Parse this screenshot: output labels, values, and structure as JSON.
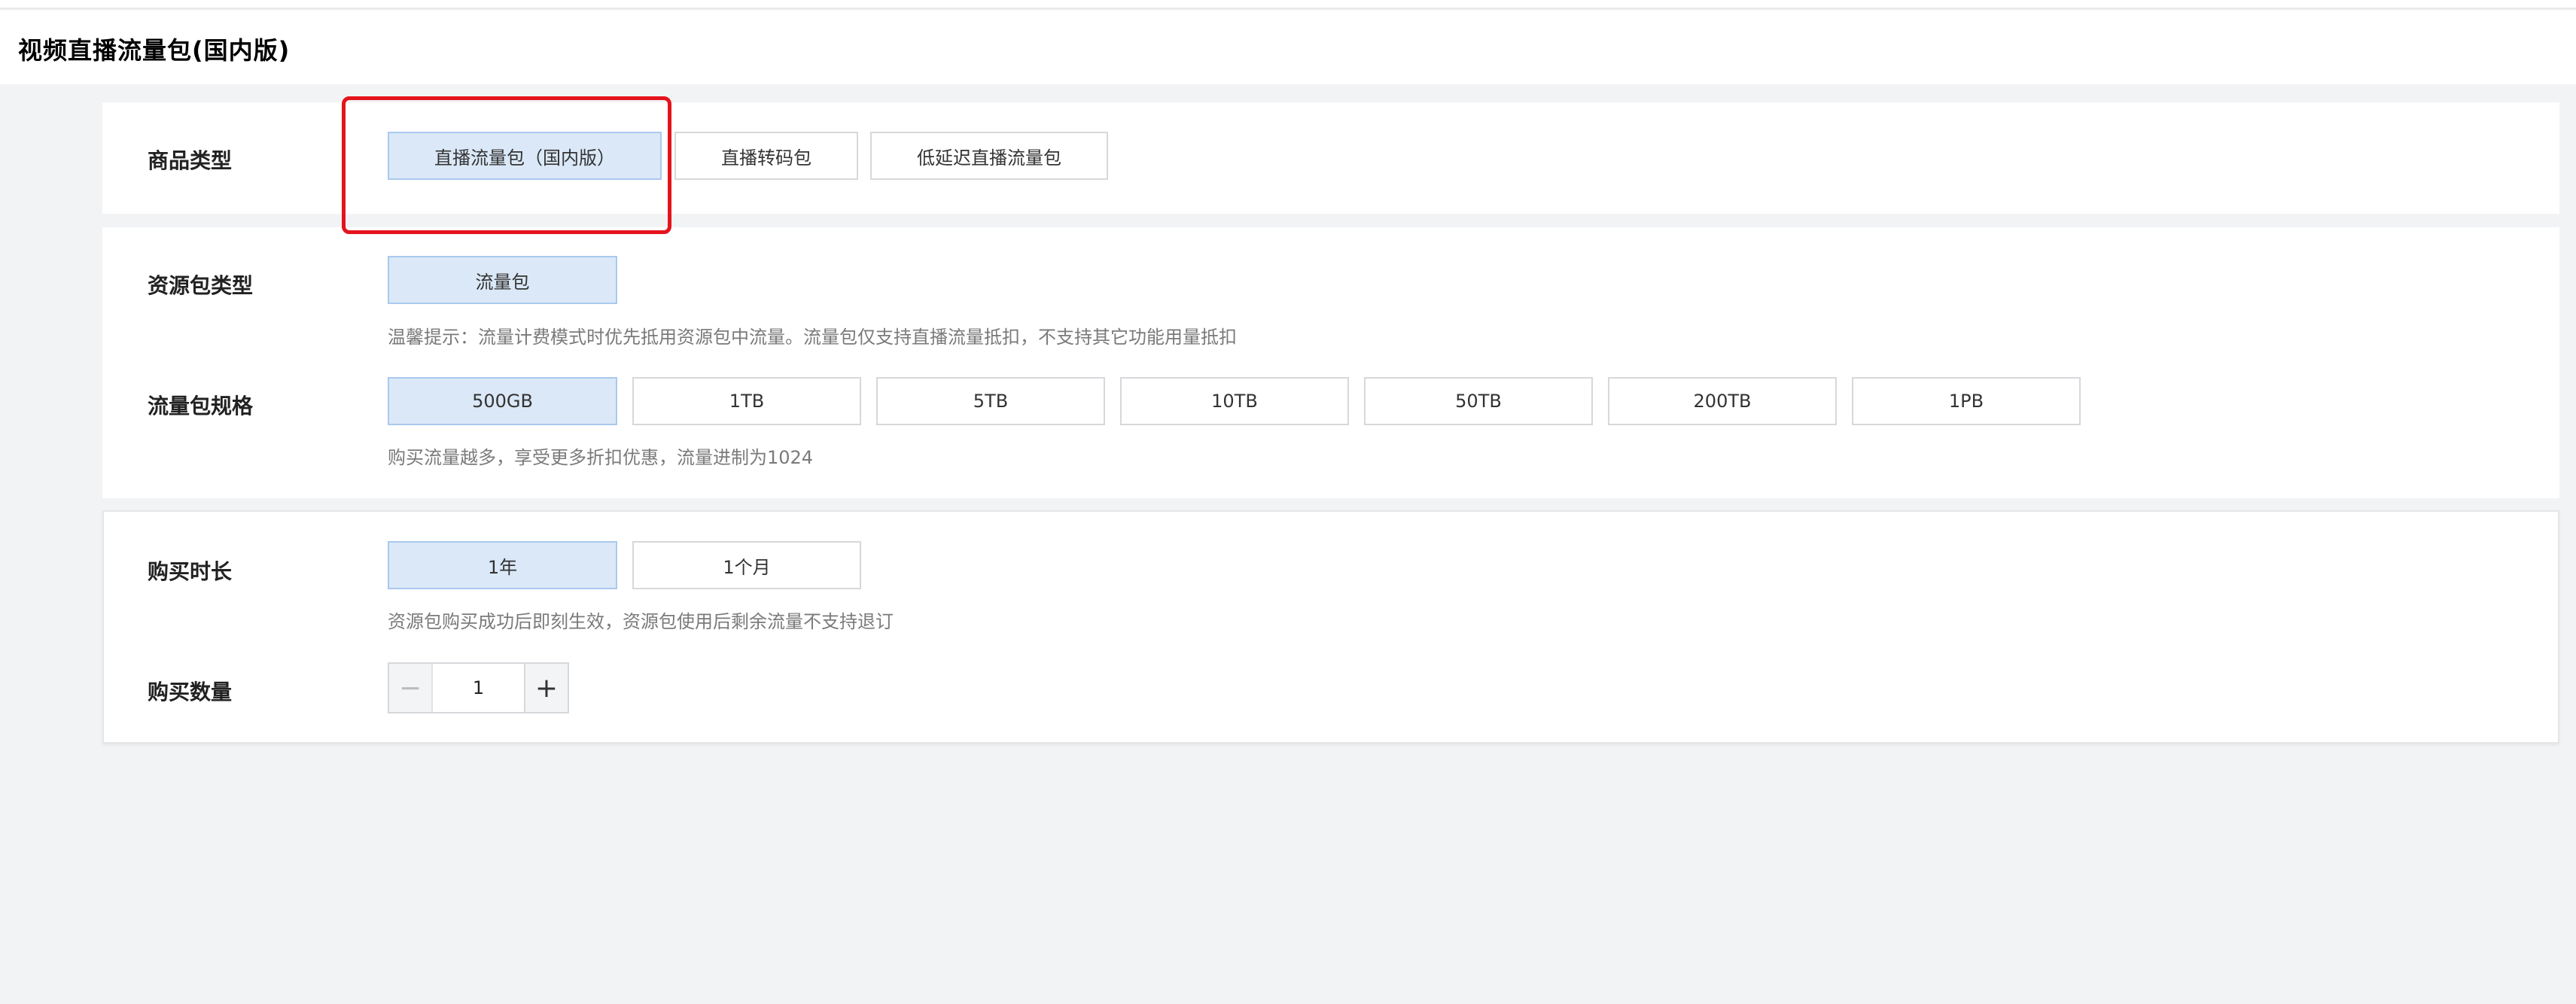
{
  "header": {
    "title": "视频直播流量包(国内版)"
  },
  "product": {
    "label": "商品类型",
    "options": [
      "直播流量包（国内版）",
      "直播转码包",
      "低延迟直播流量包"
    ],
    "selected_index": 0
  },
  "package_type": {
    "label": "资源包类型",
    "options": [
      "流量包"
    ],
    "selected_index": 0,
    "tip": "温馨提示：流量计费模式时优先抵用资源包中流量。流量包仅支持直播流量抵扣，不支持其它功能用量抵扣"
  },
  "spec": {
    "label": "流量包规格",
    "options": [
      "500GB",
      "1TB",
      "5TB",
      "10TB",
      "50TB",
      "200TB",
      "1PB"
    ],
    "selected_index": 0,
    "tip": "购买流量越多，享受更多折扣优惠，流量进制为1024"
  },
  "duration": {
    "label": "购买时长",
    "options": [
      "1年",
      "1个月"
    ],
    "selected_index": 0,
    "tip": "资源包购买成功后即刻生效，资源包使用后剩余流量不支持退订"
  },
  "quantity": {
    "label": "购买数量",
    "value": "1",
    "minus_symbol": "−",
    "plus_symbol": "+"
  },
  "colors": {
    "selected_bg": "#dbe8f7",
    "selected_border": "#a9c9ef",
    "highlight": "#e4141c"
  }
}
